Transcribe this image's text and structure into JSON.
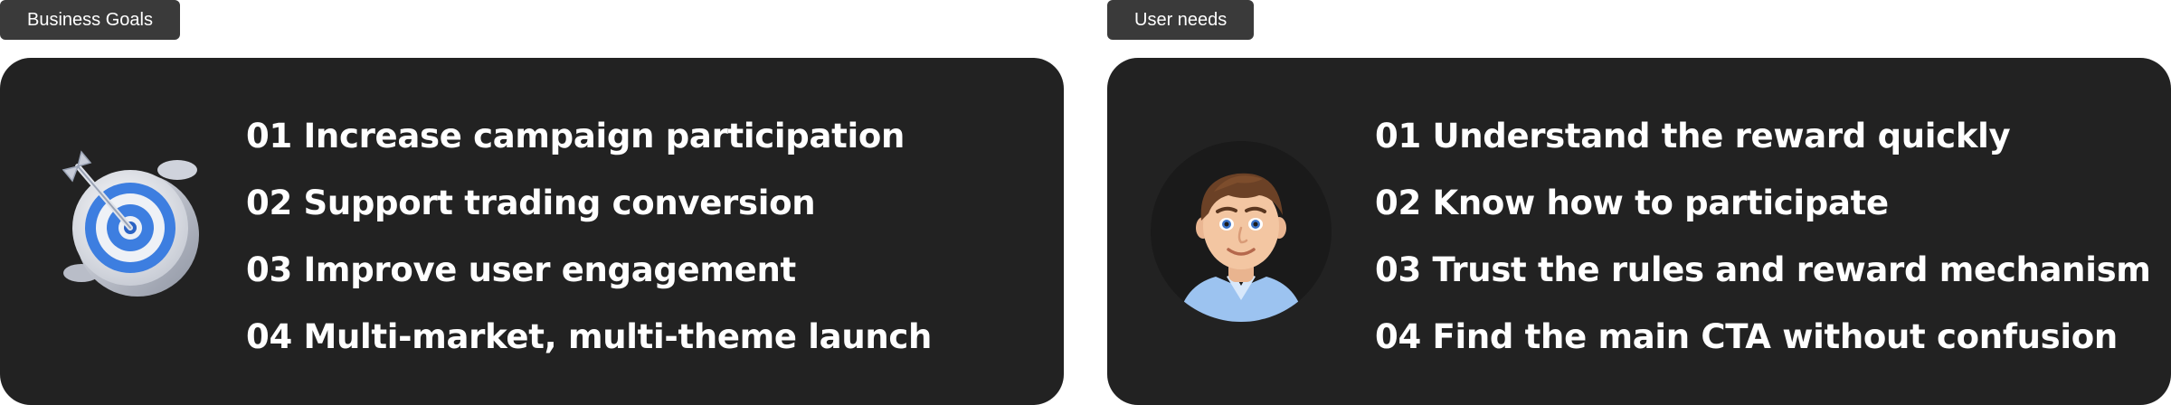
{
  "business_goals": {
    "tag_label": "Business Goals",
    "icon": "target-icon",
    "items": [
      "01 Increase campaign participation",
      "02 Support trading conversion",
      "03 Improve user engagement",
      "04 Multi-market, multi-theme launch"
    ]
  },
  "user_needs": {
    "tag_label": "User needs",
    "icon": "avatar-icon",
    "items": [
      "01 Understand the reward quickly",
      "02 Know how to participate",
      "03 Trust the rules and reward mechanism",
      "04 Find the main CTA without confusion"
    ]
  },
  "colors": {
    "panel_bg": "#222222",
    "tag_bg": "#3a3a3a",
    "text": "#ffffff",
    "accent_blue": "#3d7ee0"
  }
}
